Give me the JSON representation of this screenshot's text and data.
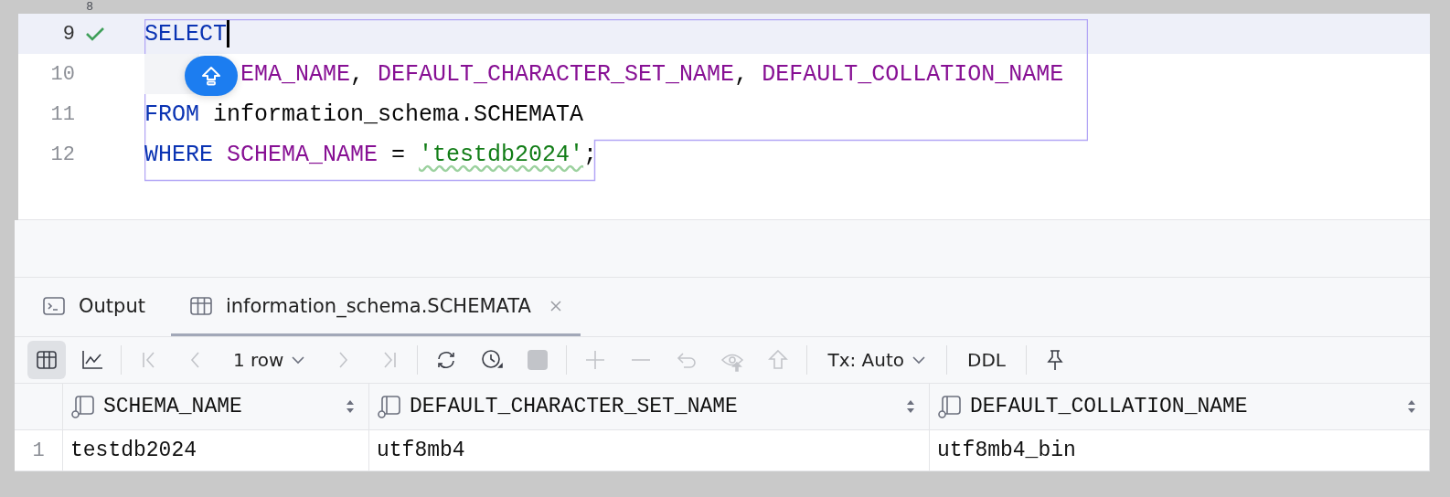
{
  "editor": {
    "lines": [
      {
        "number": "8"
      },
      {
        "number": "9",
        "current": true,
        "valid": true,
        "hint_button": false,
        "caret": true,
        "tokens": [
          {
            "kind": "keyword",
            "text": "SELECT"
          }
        ]
      },
      {
        "number": "10",
        "current": false,
        "valid": false,
        "hint_button": true,
        "tokens": [
          {
            "kind": "column",
            "text": "EMA_NAME"
          },
          {
            "kind": "plain",
            "text": ", "
          },
          {
            "kind": "column",
            "text": "DEFAULT_CHARACTER_SET_NAME"
          },
          {
            "kind": "plain",
            "text": ", "
          },
          {
            "kind": "column",
            "text": "DEFAULT_COLLATION_NAME"
          }
        ]
      },
      {
        "number": "11",
        "current": false,
        "valid": false,
        "hint_button": false,
        "tokens": [
          {
            "kind": "keyword",
            "text": "FROM"
          },
          {
            "kind": "plain",
            "text": " information_schema.SCHEMATA"
          }
        ]
      },
      {
        "number": "12",
        "current": false,
        "valid": false,
        "hint_button": false,
        "tokens": [
          {
            "kind": "keyword",
            "text": "WHERE"
          },
          {
            "kind": "column",
            "text": " SCHEMA_NAME"
          },
          {
            "kind": "plain",
            "text": " = "
          },
          {
            "kind": "string",
            "text": "'testdb2024'"
          },
          {
            "kind": "plain",
            "text": ";"
          }
        ]
      }
    ]
  },
  "tabs": [
    {
      "kind": "console",
      "label": "Output",
      "selected": false,
      "closable": false
    },
    {
      "kind": "table",
      "label": "information_schema.SCHEMATA",
      "selected": true,
      "closable": true
    }
  ],
  "toolbar": [
    {
      "kind": "grid",
      "selected": true,
      "disabled": false
    },
    {
      "kind": "chart",
      "selected": false,
      "disabled": false
    },
    {
      "kind": "sep"
    },
    {
      "kind": "first",
      "selected": false,
      "disabled": true
    },
    {
      "kind": "prev",
      "selected": false,
      "disabled": true
    },
    {
      "kind": "dropdown",
      "label": "1 row"
    },
    {
      "kind": "next",
      "selected": false,
      "disabled": true
    },
    {
      "kind": "last",
      "selected": false,
      "disabled": true
    },
    {
      "kind": "sep"
    },
    {
      "kind": "refresh",
      "selected": false,
      "disabled": false
    },
    {
      "kind": "clock",
      "selected": false,
      "disabled": false
    },
    {
      "kind": "stop",
      "selected": false,
      "disabled": true
    },
    {
      "kind": "sep"
    },
    {
      "kind": "plus",
      "selected": false,
      "disabled": true
    },
    {
      "kind": "minus",
      "selected": false,
      "disabled": true
    },
    {
      "kind": "undo",
      "selected": false,
      "disabled": true
    },
    {
      "kind": "eye",
      "selected": false,
      "disabled": true
    },
    {
      "kind": "up",
      "selected": false,
      "disabled": true
    },
    {
      "kind": "sep"
    },
    {
      "kind": "dropdown",
      "label": "Tx: Auto"
    },
    {
      "kind": "sep"
    },
    {
      "kind": "text",
      "label": "DDL"
    },
    {
      "kind": "sep"
    },
    {
      "kind": "pin",
      "selected": false,
      "disabled": false
    }
  ],
  "table": {
    "columns": [
      "SCHEMA_NAME",
      "DEFAULT_CHARACTER_SET_NAME",
      "DEFAULT_COLLATION_NAME"
    ],
    "rows": [
      {
        "number": "1",
        "cells": [
          "testdb2024",
          "utf8mb4",
          "utf8mb4_bin"
        ]
      }
    ]
  }
}
